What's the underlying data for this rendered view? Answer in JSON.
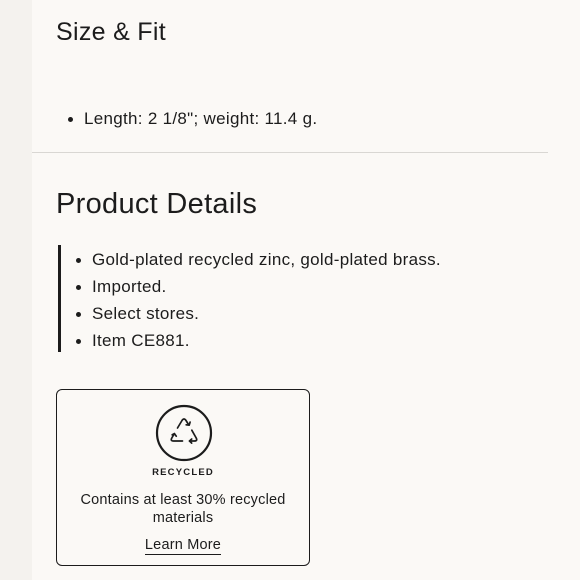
{
  "size_fit": {
    "title": "Size & Fit",
    "items": [
      "Length: 2 1/8\"; weight: 11.4 g."
    ]
  },
  "product_details": {
    "title": "Product Details",
    "items": [
      "Gold-plated recycled zinc, gold-plated brass.",
      "Imported.",
      "Select stores.",
      "Item CE881."
    ]
  },
  "recycled_card": {
    "icon": "recycle-icon",
    "label": "RECYCLED",
    "description": "Contains at least 30% recycled materials",
    "link_label": "Learn More"
  },
  "colors": {
    "background": "#fbf9f6",
    "text": "#1c1c1c",
    "divider": "#d9d7d3"
  }
}
